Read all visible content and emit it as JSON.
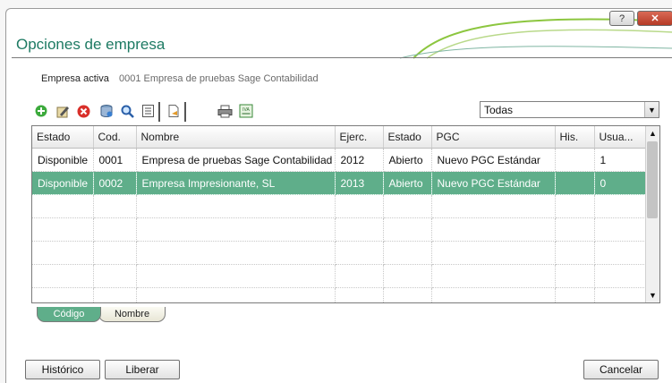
{
  "window": {
    "title": "Opciones de empresa",
    "help_icon": "question-mark",
    "close_icon": "x"
  },
  "active_company": {
    "label": "Empresa activa",
    "value": "0001 Empresa de pruebas Sage Contabilidad"
  },
  "toolbar": {
    "icons": [
      "add-icon",
      "edit-icon",
      "delete-icon",
      "database-icon",
      "search-icon",
      "list-icon",
      "document-icon",
      "print-icon",
      "iva-icon"
    ],
    "iva_label": "IVA"
  },
  "filter": {
    "selected": "Todas"
  },
  "grid": {
    "columns": [
      "Estado",
      "Cod.",
      "Nombre",
      "Ejerc.",
      "Estado",
      "PGC",
      "His.",
      "Usua..."
    ],
    "rows": [
      [
        "Disponible",
        "0001",
        "Empresa de pruebas Sage Contabilidad",
        "2012",
        "Abierto",
        "Nuevo PGC Estándar",
        "",
        "1"
      ],
      [
        "Disponible",
        "0002",
        "Empresa Impresionante, SL",
        "2013",
        "Abierto",
        "Nuevo PGC Estándar",
        "",
        "0"
      ]
    ],
    "selected_row": 1
  },
  "tabs": {
    "codigo": "Código",
    "nombre": "Nombre",
    "active": "codigo"
  },
  "buttons": {
    "historico": "Histórico",
    "liberar": "Liberar",
    "cancelar": "Cancelar"
  },
  "colors": {
    "accent": "#1d7a63",
    "selection": "#5fae8a"
  }
}
